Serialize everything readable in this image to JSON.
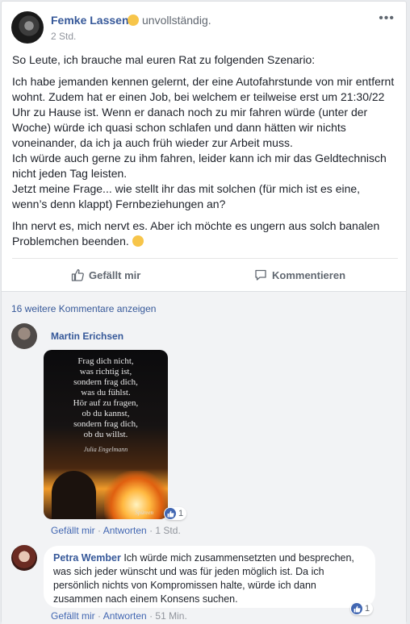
{
  "post": {
    "author": "Femke Lassen",
    "feeling": "unvollständig.",
    "time": "2 Std.",
    "paragraphs": [
      "So Leute, ich brauche mal euren Rat zu folgenden Szenario:",
      "Ich habe jemanden kennen gelernt, der eine Autofahrstunde von mir entfernt wohnt. Zudem hat er einen Job, bei welchem er teilweise erst um 21:30/22 Uhr zu Hause ist. Wenn er danach noch zu mir fahren würde (unter der Woche) würde ich quasi schon schlafen und dann hätten wir nichts voneinander, da ich ja auch früh wieder zur Arbeit muss.\nIch würde auch gerne zu ihm fahren, leider kann ich mir das Geldtechnisch nicht jeden Tag leisten.\nJetzt meine Frage... wie stellt ihr das mit solchen (für mich ist es eine, wenn’s denn klappt) Fernbeziehungen an?",
      "Ihn nervt es, mich nervt es. Aber ich möchte es ungern aus solch banalen Problemchen beenden."
    ],
    "more_icon": "ellipsis-icon"
  },
  "actions": {
    "like": "Gefällt mir",
    "comment": "Kommentieren"
  },
  "comments": {
    "more_link": "16 weitere Kommentare anzeigen",
    "items": [
      {
        "name": "Martin Erichsen",
        "image_quote": "Frag dich nicht,\nwas richtig ist,\nsondern frag dich,\nwas du fühlst.\nHör auf zu fragen,\nob du kannst,\nsondern frag dich,\nob du willst.",
        "image_signature": "Julia Engelmann",
        "image_watermark": "Spüreen",
        "reactions": "1",
        "like": "Gefällt mir",
        "reply": "Antworten",
        "time": "1 Std.",
        "sep": "·"
      },
      {
        "name": "Petra Wember",
        "text": "Ich würde mich zusammensetzten und besprechen, was sich jeder wünscht und was für jeden möglich ist. Da ich persönlich nichts von Kompromissen halte, würde ich dann zusammen nach einem Konsens suchen.",
        "reactions": "1",
        "like": "Gefällt mir",
        "reply": "Antworten",
        "time": "51 Min.",
        "sep": "·"
      }
    ]
  },
  "colors": {
    "link": "#365899",
    "accent": "#4267b2",
    "muted": "#90949c"
  }
}
